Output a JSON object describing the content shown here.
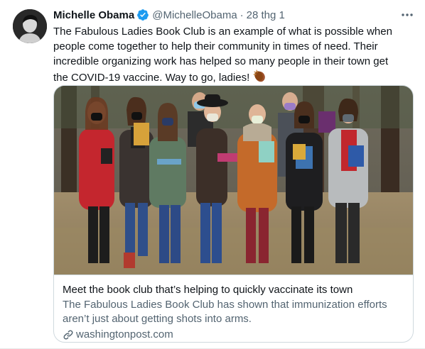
{
  "tweet": {
    "author": {
      "display_name": "Michelle Obama",
      "handle": "@MichelleObama",
      "verified": true,
      "avatar_icon": "profile-photo"
    },
    "separator": "·",
    "timestamp": "28 thg 1",
    "more_icon": "ellipsis-icon",
    "text_lines": [
      "The Fabulous Ladies Book Club is an example of what is possible when",
      "people come together to help their community in times of need. Their",
      "incredible organizing work has helped so many people in their town get",
      "the COVID-19 vaccine. Way to go, ladies!"
    ],
    "emoji": "clapping-hands-emoji"
  },
  "card": {
    "image_icon": "article-photo",
    "title": "Meet the book club that’s helping to quickly vaccinate its town",
    "description_lines": [
      "The Fabulous Ladies Book Club has shown that immunization efforts",
      "aren’t just about getting shots into arms."
    ],
    "domain": "washingtonpost.com",
    "domain_icon": "link-icon"
  },
  "colors": {
    "text_primary": "#0f1419",
    "text_secondary": "#536471",
    "verified_blue": "#1d9bf0",
    "border": "#cfd9de"
  }
}
